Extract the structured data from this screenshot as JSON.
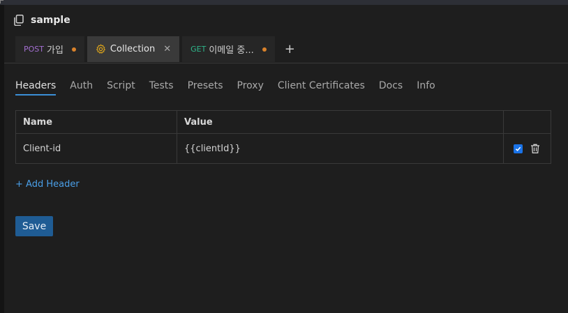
{
  "collection": {
    "title": "sample"
  },
  "tabs": [
    {
      "method": "POST",
      "label": "가입",
      "modified": true
    },
    {
      "label": "Collection",
      "active": true
    },
    {
      "method": "GET",
      "label": "이메일 중...",
      "modified": true
    }
  ],
  "add_tab_label": "+",
  "subtabs": [
    "Headers",
    "Auth",
    "Script",
    "Tests",
    "Presets",
    "Proxy",
    "Client Certificates",
    "Docs",
    "Info"
  ],
  "active_subtab": "Headers",
  "headers_table": {
    "columns": [
      "Name",
      "Value"
    ],
    "rows": [
      {
        "name": "Client-id",
        "value": "{{clientId}}",
        "enabled": true
      }
    ]
  },
  "add_header_label": "+ Add Header",
  "save_label": "Save",
  "colors": {
    "accent": "#3b8fd6",
    "variable": "#2fb58a",
    "post": "#a36fd1",
    "get": "#2fb58a",
    "modified_dot": "#d9822b",
    "save_bg": "#1f5c94"
  }
}
